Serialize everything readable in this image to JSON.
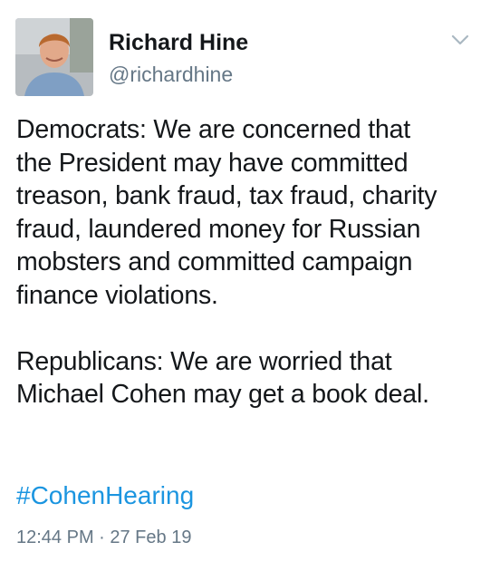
{
  "tweet": {
    "author": {
      "display_name": "Richard Hine",
      "handle": "@richardhine",
      "avatar_icon": "profile-photo"
    },
    "menu_icon": "chevron-down-icon",
    "paragraph_1": "Democrats: We are concerned that\nthe President may have committed\ntreason, bank fraud, tax fraud, charity\nfraud, laundered money for Russian\nmobsters and committed campaign\nfinance violations.",
    "paragraph_2": "Republicans: We are worried that\nMichael Cohen may get a book deal.",
    "hashtag": "#CohenHearing",
    "timestamp": "12:44 PM · 27 Feb 19"
  },
  "colors": {
    "text": "#14171a",
    "secondary": "#657786",
    "link": "#1b95e0",
    "background": "#ffffff"
  }
}
